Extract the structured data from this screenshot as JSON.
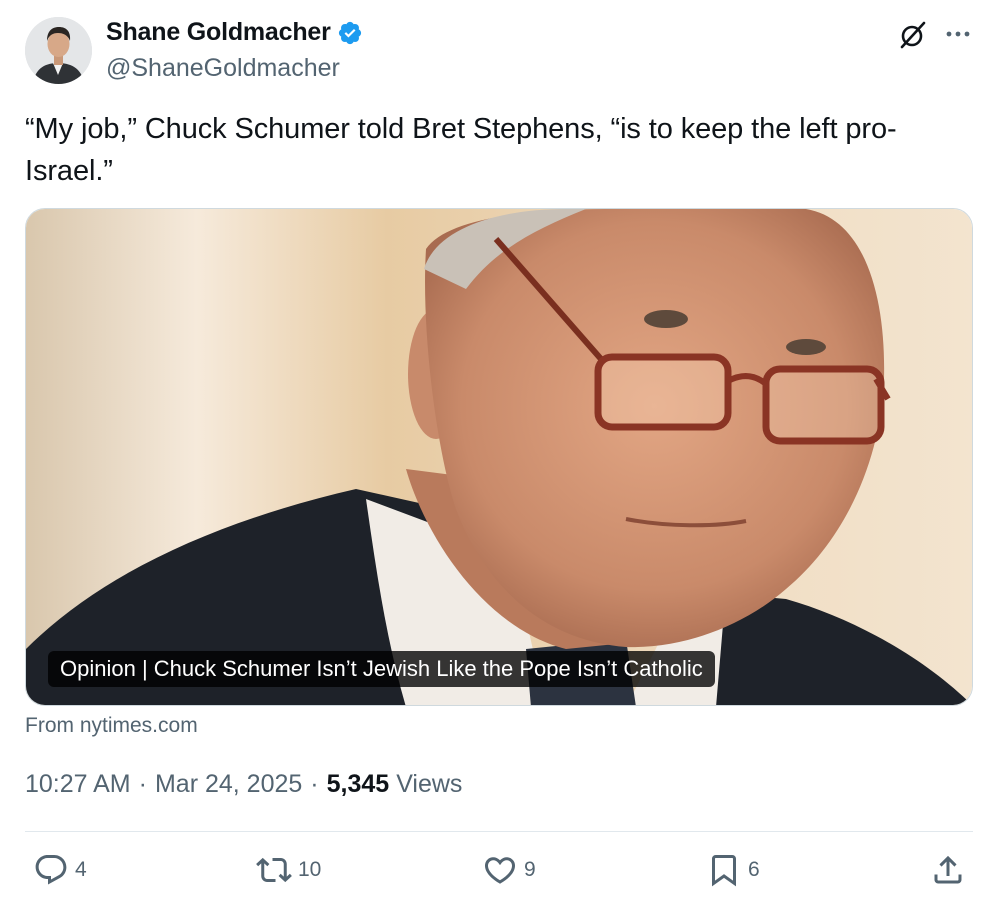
{
  "author": {
    "display_name": "Shane Goldmacher",
    "handle": "@ShaneGoldmacher",
    "verified": true
  },
  "tweet": {
    "text": "“My job,” Chuck Schumer told Bret Stephens, “is to keep the left pro-Israel.”"
  },
  "card": {
    "title": "Opinion | Chuck Schumer Isn’t Jewish Like the Pope Isn’t Catholic",
    "source": "From nytimes.com"
  },
  "meta": {
    "time": "10:27 AM",
    "date": "Mar 24, 2025",
    "views_count": "5,345",
    "views_label": "Views"
  },
  "actions": {
    "replies": "4",
    "retweets": "10",
    "likes": "9",
    "bookmarks": "6"
  },
  "icons": {
    "verified": "verified-badge-icon",
    "grok": "grok-icon",
    "more": "more-icon",
    "reply": "reply-icon",
    "retweet": "retweet-icon",
    "like": "heart-icon",
    "bookmark": "bookmark-icon",
    "share": "share-icon"
  },
  "colors": {
    "text": "#0f1419",
    "secondary": "#536471",
    "verified": "#1d9bf0",
    "divider": "#e1e8ed"
  }
}
